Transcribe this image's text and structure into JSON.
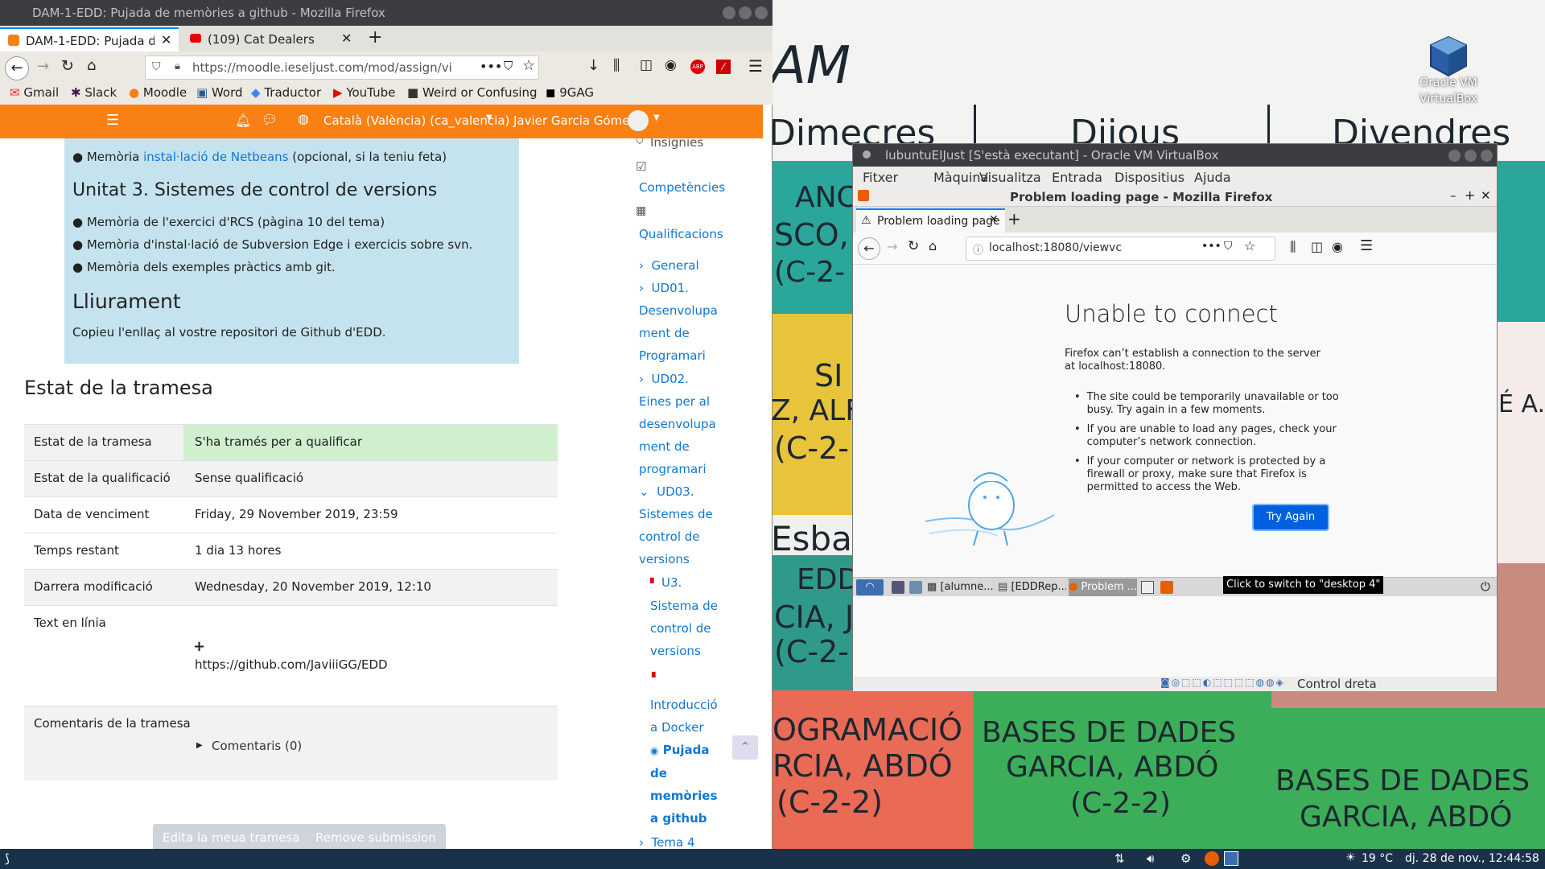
{
  "firefox": {
    "window_title": "DAM-1-EDD: Pujada de memòries a github - Mozilla Firefox",
    "tabs": [
      {
        "label": "DAM-1-EDD: Pujada de",
        "active": true
      },
      {
        "label": "(109) Cat Dealers",
        "active": false
      }
    ],
    "url": "https://moodle.ieseljust.com/mod/assign/vi",
    "bookmarks": [
      "Gmail",
      "Slack",
      "Moodle",
      "Word",
      "Traductor",
      "YouTube",
      "Weird or Confusing",
      "9GAG"
    ]
  },
  "moodle": {
    "language": "Català (València) (ca_valencia)",
    "user": "Javier Garcia Gómez",
    "memoria_item_prefix": "Memòria ",
    "memoria_item_link": "instal·lació de Netbeans",
    "memoria_item_suffix": " (opcional, si la teniu feta)",
    "unit3_title": "Unitat 3. Sistemes de control de versions",
    "unit3_items": [
      "Memòria de l'exercici d'RCS (pàgina 10 del tema)",
      "Memòria d'instal·lació de Subversion Edge i exercicis sobre svn.",
      "Memòria dels exemples pràctics amb git."
    ],
    "lliurament_title": "Lliurament",
    "lliurament_text": "Copieu l'enllaç al vostre repositori de Github d'EDD.",
    "status_title": "Estat de la tramesa",
    "status_rows": [
      {
        "label": "Estat de la tramesa",
        "value": "S'ha tramés per a qualificar"
      },
      {
        "label": "Estat de la qualificació",
        "value": "Sense qualificació"
      },
      {
        "label": "Data de venciment",
        "value": "Friday, 29 November 2019, 23:59"
      },
      {
        "label": "Temps restant",
        "value": "1 dia 13 hores"
      },
      {
        "label": "Darrera modificació",
        "value": "Wednesday, 20 November 2019, 12:10"
      },
      {
        "label": "Text en línia",
        "value": "https://github.com/JaviiiGG/EDD"
      }
    ],
    "comments_label": "Comentaris de la tramesa",
    "comments_link": "Comentaris (0)",
    "edit_button": "Edita la meua tramesa",
    "remove_button": "Remove submission",
    "sidebar": {
      "insignies": "Insígnies",
      "competencies": "Competències",
      "qualificacions": "Qualificacions",
      "general": "General",
      "ud01": [
        "UD01.",
        "Desenvolupa",
        "ment de",
        "Programari"
      ],
      "ud02": [
        "UD02.",
        "Eines per al",
        "desenvolupa",
        "ment de",
        "programari"
      ],
      "ud03": [
        "UD03.",
        "Sistemes de",
        "control de",
        "versions"
      ],
      "u3": [
        "U3.",
        "Sistema de",
        "control de",
        "versions"
      ],
      "docker": [
        "Introducció",
        "a Docker"
      ],
      "pujada": [
        "Pujada",
        "de",
        "memòries",
        "a github"
      ],
      "tema4": "Tema 4"
    }
  },
  "desktop": {
    "vbox_icon_label": [
      "Oracle VM",
      "VirtualBox"
    ],
    "wallpaper_text": {
      "am": "AM",
      "dimecres": "Dimecres",
      "dijous": "Dijous",
      "divendres": "Divendres",
      "anco": "ANC",
      "sco": "SCO,",
      "c22a": "(C-2-",
      "si": "SI",
      "alf": "Z, ALF",
      "c2b": "(C-2-",
      "esba": "Esba",
      "edd": "EDD",
      "cia": "CIA, J",
      "c2c": "(C-2-",
      "programacio": "OGRAMACIÓ",
      "garcia1": "RCIA, ABDÓ",
      "c222a": "(C-2-2)",
      "bases1": "BASES DE DADES",
      "garcia2": "GARCIA, ABDÓ",
      "c222b": "(C-2-2)",
      "bases2": "BASES DE DADES",
      "garcia3": "GARCIA, ABDÓ",
      "ea": "É A."
    }
  },
  "taskbar": {
    "temperature": "19 °C",
    "clock": "dj. 28 de nov., 12:44:58"
  },
  "virtualbox": {
    "title": "lubuntuEIJust [S'està executant] - Oracle VM VirtualBox",
    "menu": [
      "Fitxer",
      "Màquina",
      "Visualitza",
      "Entrada",
      "Dispositius",
      "Ajuda"
    ],
    "guest_firefox": {
      "window_title": "Problem loading page - Mozilla Firefox",
      "tab_label": "Problem loading page",
      "url": "localhost:18080/viewvc",
      "error_title": "Unable to connect",
      "error_desc": "Firefox can’t establish a connection to the server at localhost:18080.",
      "bullets": [
        "The site could be temporarily unavailable or too busy. Try again in a few moments.",
        "If you are unable to load any pages, check your computer’s network connection.",
        "If your computer or network is protected by a firewall or proxy, make sure that Firefox is permitted to access the Web."
      ],
      "try_again": "Try Again"
    },
    "guest_taskbar": [
      "[alumne...",
      "[EDDRep...",
      "Problem ..."
    ],
    "tooltip": "Click to switch to \"desktop 4\"",
    "host_key": "Control dreta"
  }
}
